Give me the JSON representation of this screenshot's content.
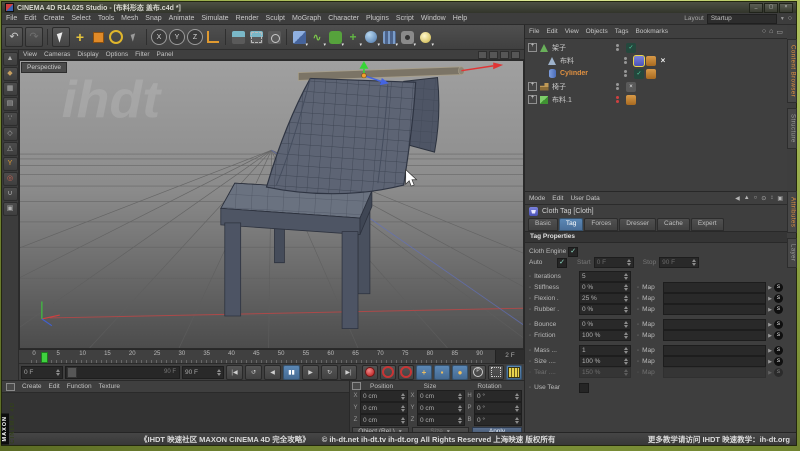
{
  "colors": {
    "accent": "#5b87b5",
    "selorange": "#e09040",
    "playhead": "#3fd13f",
    "record": "#c73535",
    "frame_green": "#8aa03f",
    "viewport_top": "#a0a0a0",
    "viewport_bottom": "#4c4c4c",
    "cloth_fill": "#5d6474"
  },
  "window": {
    "title": "CINEMA 4D R14.025 Studio - [布料形态 盖布.c4d *]",
    "buttons": [
      "minimize",
      "maximize",
      "close"
    ]
  },
  "menu_bar": {
    "items": [
      "File",
      "Edit",
      "Create",
      "Select",
      "Tools",
      "Mesh",
      "Snap",
      "Animate",
      "Simulate",
      "Render",
      "Sculpt",
      "MoGraph",
      "Character",
      "Plugins",
      "Script",
      "Window",
      "Help"
    ],
    "layout_label": "Layout",
    "layout_value": "Startup"
  },
  "toolbar": {
    "icons": [
      "undo",
      "redo",
      "live-selection",
      "move",
      "scale",
      "rotate",
      "last-tool",
      "x-axis-lock",
      "y-axis-lock",
      "z-axis-lock",
      "coordinate-system",
      "render-view",
      "render-region",
      "render-settings",
      "primitive-cube",
      "spline",
      "subdivision",
      "deformer",
      "environment",
      "floor",
      "camera",
      "light"
    ],
    "axis_letters": {
      "x": "X",
      "y": "Y",
      "z": "Z"
    }
  },
  "tool_palette": {
    "icons": [
      "convert",
      "model-mode",
      "texture-mode",
      "workplane",
      "points-mode",
      "edges-mode",
      "polygons-mode",
      "axis-mode",
      "snap",
      "magnet",
      "lock"
    ]
  },
  "viewport": {
    "menu": [
      "View",
      "Cameras",
      "Display",
      "Options",
      "Filter",
      "Panel"
    ],
    "camera_label": "Perspective",
    "watermark": "ihdt",
    "corner_icons": [
      "pan-icon",
      "orbit-icon",
      "zoom-icon",
      "toggle-view-icon"
    ]
  },
  "object_manager": {
    "menu": [
      "File",
      "Edit",
      "View",
      "Objects",
      "Tags",
      "Bookmarks"
    ],
    "header_icons": [
      "search-icon",
      "home-icon",
      "panel-icon"
    ],
    "items": [
      {
        "name": "架子",
        "icon": "cone",
        "expander": true,
        "indent": 0,
        "selected": false,
        "dots": "gray",
        "tags": [
          "check"
        ]
      },
      {
        "name": "布料",
        "icon": "pyramid",
        "expander": false,
        "indent": 1,
        "selected": false,
        "dots": "gray",
        "tags": [
          "cloth-selected",
          "cache",
          "fix"
        ]
      },
      {
        "name": "Cylinder",
        "icon": "cylinder",
        "expander": false,
        "indent": 1,
        "selected": true,
        "dots": "gray",
        "tags": [
          "check",
          "cache"
        ]
      },
      {
        "name": "椅子",
        "icon": "group",
        "expander": true,
        "indent": 0,
        "selected": false,
        "dots": "gray",
        "tags": [
          "xcross"
        ]
      },
      {
        "name": "布料.1",
        "icon": "polygon",
        "expander": true,
        "indent": 0,
        "selected": false,
        "dots": "red",
        "tags": [
          "cache"
        ]
      }
    ]
  },
  "right_tabs": {
    "top": [
      "Content Browser",
      "Structure"
    ],
    "bottom": [
      "Attributes",
      "Layer"
    ]
  },
  "attribute_manager": {
    "menu": [
      "Mode",
      "Edit",
      "User Data"
    ],
    "header_icons": [
      "nav-back-icon",
      "pin-icon",
      "search-icon",
      "lock-icon",
      "sync-icon",
      "panel-icon"
    ],
    "title": "Cloth Tag [Cloth]",
    "tabs": [
      "Basic",
      "Tag",
      "Forces",
      "Dresser",
      "Cache",
      "Expert"
    ],
    "active_tab": "Tag",
    "section": "Tag Properties",
    "engine_label": "Cloth Engine",
    "engine_checked": true,
    "auto_label": "Auto",
    "auto_checked": true,
    "start_label": "Start",
    "start_value": "0 F",
    "stop_label": "Stop",
    "stop_value": "90 F",
    "map_label": "Map",
    "groups": [
      [
        {
          "label": "Iterations",
          "value": "5",
          "map": false,
          "disabled": false
        },
        {
          "label": "Stiffness",
          "value": "0 %",
          "map": true,
          "disabled": false
        },
        {
          "label": "Flexion .",
          "value": "25 %",
          "map": true,
          "disabled": false
        },
        {
          "label": "Rubber .",
          "value": "0 %",
          "map": true,
          "disabled": false
        }
      ],
      [
        {
          "label": "Bounce",
          "value": "0 %",
          "map": true,
          "disabled": false
        },
        {
          "label": "Friction",
          "value": "100 %",
          "map": true,
          "disabled": false
        }
      ],
      [
        {
          "label": "Mass ...",
          "value": "1",
          "map": true,
          "disabled": false
        },
        {
          "label": "Size ....",
          "value": "100 %",
          "map": true,
          "disabled": false
        },
        {
          "label": "Tear ....",
          "value": "150 %",
          "map": true,
          "disabled": true
        }
      ]
    ],
    "use_tear_label": "Use Tear",
    "use_tear_checked": false
  },
  "timeline": {
    "ticks": [
      "0",
      "5",
      "10",
      "15",
      "20",
      "25",
      "30",
      "35",
      "40",
      "45",
      "50",
      "55",
      "60",
      "65",
      "70",
      "75",
      "80",
      "85",
      "90"
    ],
    "current_frame": "2 F",
    "range_start": "0 F",
    "range_end": "90 F",
    "playhead_frame": 2
  },
  "transport": {
    "buttons": [
      {
        "name": "goto-start",
        "active": false
      },
      {
        "name": "play-reverse",
        "active": false
      },
      {
        "name": "step-back",
        "active": false
      },
      {
        "name": "pause",
        "active": true
      },
      {
        "name": "step-forward",
        "active": false
      },
      {
        "name": "play-loop",
        "active": false
      },
      {
        "name": "goto-end",
        "active": false
      }
    ],
    "key_buttons": [
      {
        "name": "record-keyframe",
        "kind": "record-dot"
      },
      {
        "name": "autokeying",
        "kind": "record-ring"
      },
      {
        "name": "keyframe-selection",
        "kind": "record-ring"
      },
      {
        "name": "key-position",
        "kind": "toggle-active",
        "glyph": "+"
      },
      {
        "name": "key-scale",
        "kind": "toggle-active",
        "glyph": "▪"
      },
      {
        "name": "key-rotation",
        "kind": "toggle-active",
        "glyph": "●"
      },
      {
        "name": "key-parameter",
        "kind": "pcircle",
        "glyph": "P"
      },
      {
        "name": "key-pla",
        "kind": "pla"
      },
      {
        "name": "timeline-mode",
        "kind": "film"
      }
    ]
  },
  "materials": {
    "menu": [
      "Create",
      "Edit",
      "Function",
      "Texture"
    ]
  },
  "coordinates": {
    "headers": [
      "Position",
      "Size",
      "Rotation"
    ],
    "rows": [
      [
        {
          "axis": "X",
          "value": "0 cm"
        },
        {
          "axis": "X",
          "value": "0 cm"
        },
        {
          "axis": "H",
          "value": "0 °"
        }
      ],
      [
        {
          "axis": "Y",
          "value": "0 cm"
        },
        {
          "axis": "Y",
          "value": "0 cm"
        },
        {
          "axis": "P",
          "value": "0 °"
        }
      ],
      [
        {
          "axis": "Z",
          "value": "0 cm"
        },
        {
          "axis": "Z",
          "value": "0 cm"
        },
        {
          "axis": "B",
          "value": "0 °"
        }
      ]
    ],
    "mode_value": "Object (Rel.)",
    "size_value": "Size",
    "apply_label": "Apply"
  },
  "status_bar": {
    "left": "《IHDT 映速社区 MAXON CINEMA 4D 完全攻略》",
    "center": "© ih-dt.net  ih-dt.tv  ih-dt.org  All Rights Reserved 上海映速 版权所有",
    "right": "更多教学请访问 IHDT 映速教学：ih-dt.org"
  },
  "branding": {
    "maxon": "MAXON",
    "cinema": "CINEMA 4D"
  }
}
